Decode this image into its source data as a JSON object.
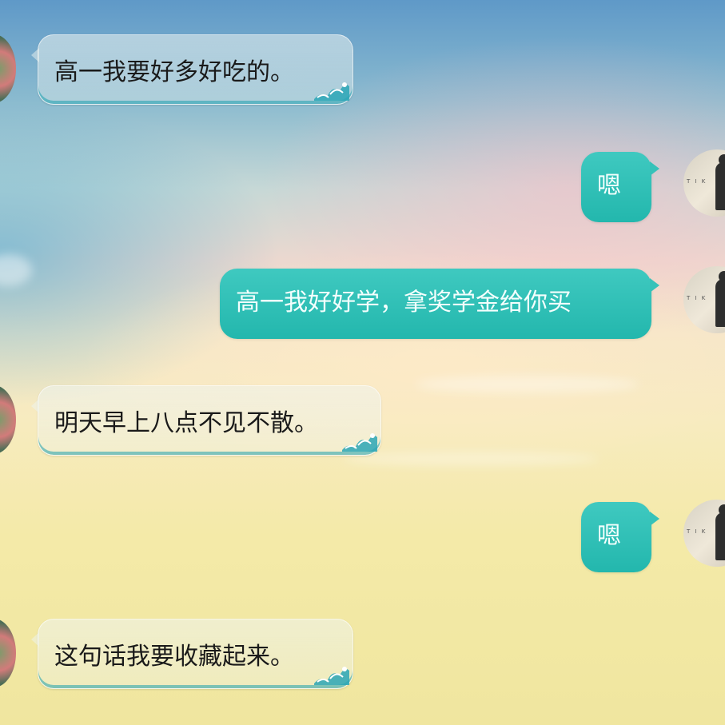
{
  "conversation": {
    "messages": [
      {
        "side": "received",
        "text": "高一我要好多好吃的。"
      },
      {
        "side": "sent",
        "text": "嗯"
      },
      {
        "side": "sent",
        "text": "高一我好好学，拿奖学金给你买"
      },
      {
        "side": "received",
        "text": "明天早上八点不见不散。"
      },
      {
        "side": "sent",
        "text": "嗯"
      },
      {
        "side": "received",
        "text": "这句话我要收藏起来。"
      }
    ]
  },
  "avatars": {
    "sent_avatar_caption": "T I K"
  },
  "colors": {
    "sent_bubble": "#2ebfb5",
    "received_bubble_accent": "#1ea0af",
    "sky_top": "#5f99c8",
    "sky_bottom": "#f0e69f"
  },
  "icons": {
    "received_bubble_decoration": "wave-icon"
  }
}
